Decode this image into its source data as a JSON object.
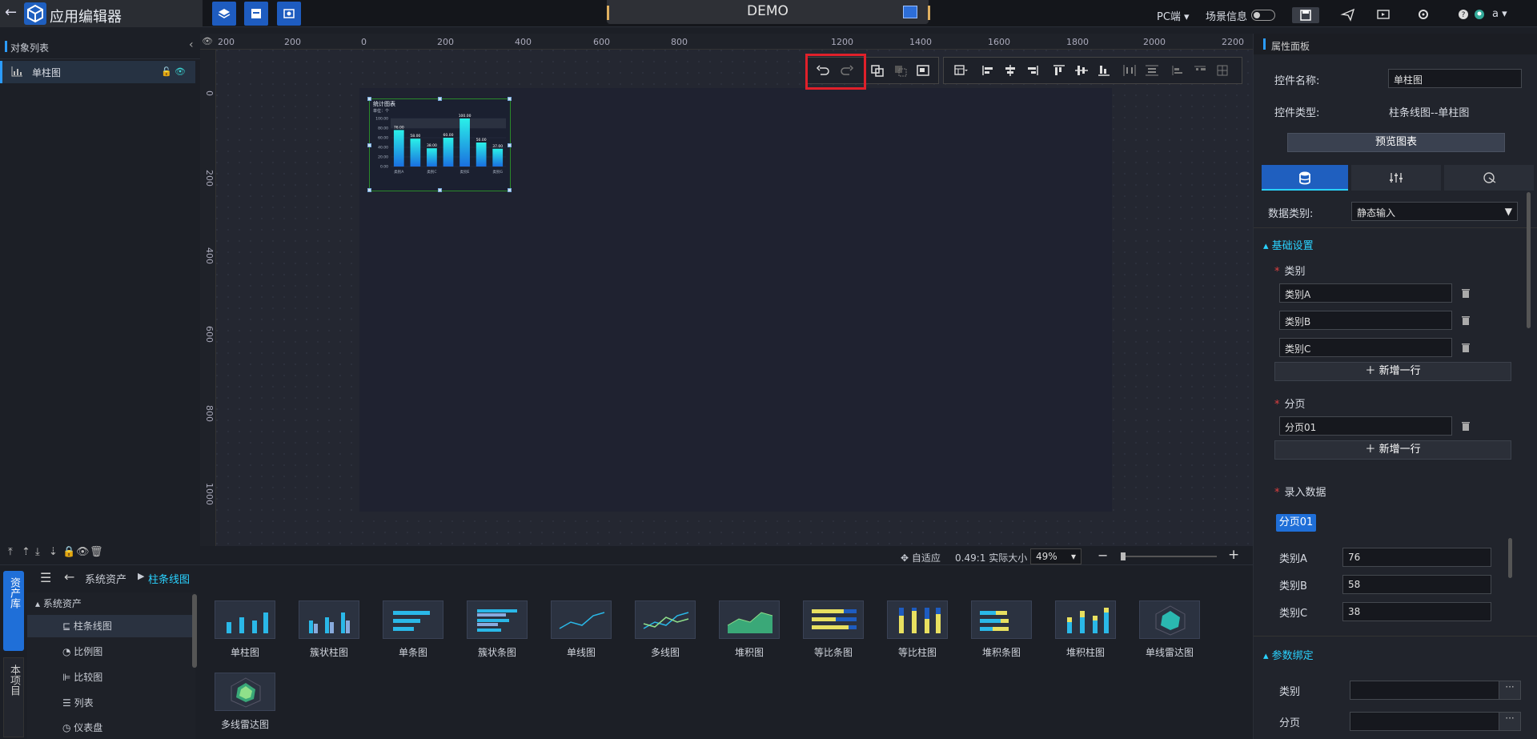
{
  "app": {
    "title": "应用编辑器",
    "project_name": "DEMO"
  },
  "topbar": {
    "device": "PC端",
    "scene_info": "场景信息",
    "user": "a"
  },
  "objects_panel": {
    "title": "对象列表",
    "items": [
      {
        "label": "单柱图"
      }
    ]
  },
  "ruler": {
    "h_ticks": [
      "200",
      "0",
      "200",
      "400",
      "600",
      "800",
      "1200",
      "1400",
      "1600",
      "1800",
      "2000",
      "2200"
    ],
    "v_ticks": [
      "0",
      "200",
      "400",
      "600",
      "800",
      "1000"
    ]
  },
  "widget_chart": {
    "title": "统计图表",
    "unit": "单位：个",
    "y_ticks": [
      "100.00",
      "80.00",
      "60.00",
      "40.00",
      "20.00",
      "0.00"
    ],
    "categories": [
      "类别A",
      "类别C",
      "类别E",
      "类别G"
    ],
    "values": [
      76,
      58,
      38,
      60,
      100,
      50,
      37
    ],
    "value_labels": [
      "76.00",
      "58.00",
      "38.00",
      "60.00",
      "100.00",
      "50.00",
      "37.00"
    ]
  },
  "zoombar": {
    "fit": "自适应",
    "ratio": "0.49:1 实际大小",
    "zoom": "49%"
  },
  "assets": {
    "tab_assets": "资产库",
    "tab_project": "本项目",
    "breadcrumb_root": "系统资产",
    "breadcrumb_current": "柱条线图",
    "tree_root": "系统资产",
    "tree_items": [
      "柱条线图",
      "比例图",
      "比较图",
      "列表",
      "仪表盘"
    ],
    "thumbnails": [
      "单柱图",
      "簇状柱图",
      "单条图",
      "簇状条图",
      "单线图",
      "多线图",
      "堆积图",
      "等比条图",
      "等比柱图",
      "堆积条图",
      "堆积柱图",
      "单线雷达图",
      "多线雷达图"
    ]
  },
  "properties": {
    "title": "属性面板",
    "name_label": "控件名称:",
    "name_value": "单柱图",
    "type_label": "控件类型:",
    "type_value": "柱条线图--单柱图",
    "preview_button": "预览图表",
    "data_type_label": "数据类别:",
    "data_type_value": "静态输入",
    "basic_settings": "基础设置",
    "category_label": "类别",
    "categories": [
      "类别A",
      "类别B",
      "类别C"
    ],
    "add_row": "新增一行",
    "page_label": "分页",
    "pages": [
      "分页01"
    ],
    "entry_label": "录入数据",
    "entry_page_tab": "分页01",
    "entries": [
      {
        "label": "类别A",
        "value": "76"
      },
      {
        "label": "类别B",
        "value": "58"
      },
      {
        "label": "类别C",
        "value": "38"
      }
    ],
    "param_binding": "参数绑定",
    "bind_category": "类别",
    "bind_page": "分页"
  }
}
